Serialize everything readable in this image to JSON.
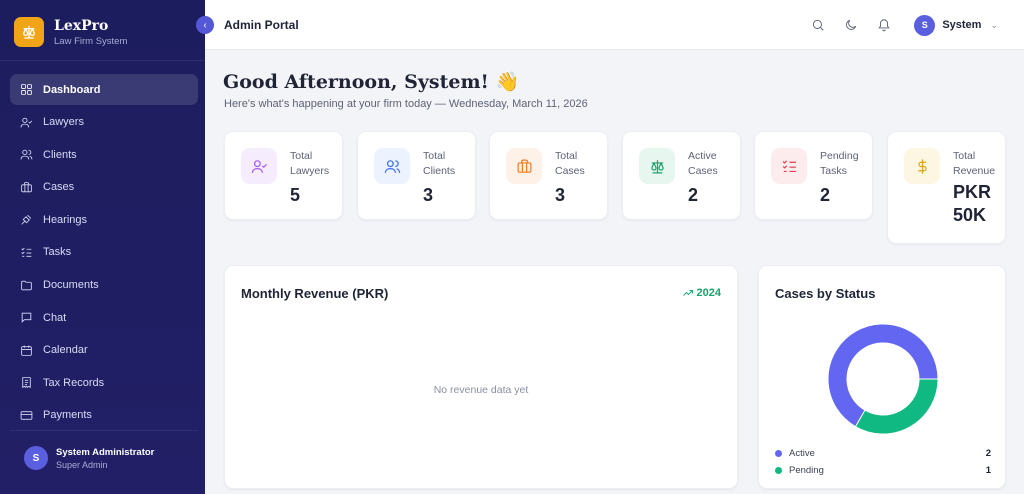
{
  "brand": {
    "name": "LexPro",
    "subtitle": "Law Firm System",
    "logo_icon": "scales-icon",
    "accent": "#f2a417"
  },
  "sidebar": {
    "items": [
      {
        "label": "Dashboard",
        "icon": "grid-icon",
        "active": true
      },
      {
        "label": "Lawyers",
        "icon": "user-check-icon"
      },
      {
        "label": "Clients",
        "icon": "users-icon"
      },
      {
        "label": "Cases",
        "icon": "briefcase-icon"
      },
      {
        "label": "Hearings",
        "icon": "gavel-icon"
      },
      {
        "label": "Tasks",
        "icon": "list-check-icon"
      },
      {
        "label": "Documents",
        "icon": "folder-icon"
      },
      {
        "label": "Chat",
        "icon": "chat-icon"
      },
      {
        "label": "Calendar",
        "icon": "calendar-icon"
      },
      {
        "label": "Tax Records",
        "icon": "receipt-icon"
      },
      {
        "label": "Payments",
        "icon": "credit-card-icon"
      }
    ],
    "user": {
      "initial": "S",
      "name": "System Administrator",
      "role": "Super Admin"
    }
  },
  "topbar": {
    "title": "Admin Portal",
    "user": {
      "initial": "S",
      "name": "System"
    }
  },
  "greeting": {
    "title": "Good Afternoon, System! 👋",
    "subtitle": "Here's what's happening at your firm today — Wednesday, March 11, 2026"
  },
  "stats": [
    {
      "label": "Total Lawyers",
      "value": "5",
      "icon": "user-check-icon",
      "color": "#a855f7",
      "bg": "#f5edfe"
    },
    {
      "label": "Total Clients",
      "value": "3",
      "icon": "users-icon",
      "color": "#3b6ef5",
      "bg": "#ecf2fe"
    },
    {
      "label": "Total Cases",
      "value": "3",
      "icon": "briefcase-icon",
      "color": "#f07b1e",
      "bg": "#fef2e8"
    },
    {
      "label": "Active Cases",
      "value": "2",
      "icon": "scales-icon",
      "color": "#1aa36a",
      "bg": "#e7f7ef"
    },
    {
      "label": "Pending Tasks",
      "value": "2",
      "icon": "list-check-icon",
      "color": "#e23b4a",
      "bg": "#fdecee"
    },
    {
      "label": "Total Revenue",
      "value": "PKR 50K",
      "icon": "dollar-icon",
      "color": "#d9a21a",
      "bg": "#fdf6e2"
    }
  ],
  "revenue_panel": {
    "title": "Monthly Revenue (PKR)",
    "year": "2024",
    "empty_message": "No revenue data yet"
  },
  "status_panel": {
    "title": "Cases by Status",
    "chart_data": {
      "type": "pie",
      "labels": [
        "Active",
        "Pending"
      ],
      "values": [
        2,
        1
      ],
      "colors": [
        "#6366f1",
        "#10b981"
      ]
    }
  }
}
